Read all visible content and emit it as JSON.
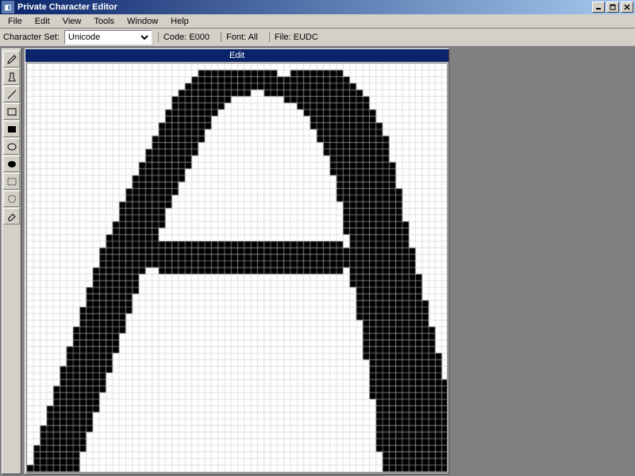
{
  "window": {
    "title": "Private Character Editor",
    "minimize": "_",
    "maximize": "□",
    "close": "×"
  },
  "menubar": [
    "File",
    "Edit",
    "View",
    "Tools",
    "Window",
    "Help"
  ],
  "toolbar": {
    "charset_label": "Character Set:",
    "charset_value": "Unicode",
    "code_label": "Code:",
    "code_value": "E000",
    "font_label": "Font:",
    "font_value": "All",
    "file_label": "File:",
    "file_value": "EUDC"
  },
  "tools": [
    {
      "name": "pencil-tool"
    },
    {
      "name": "brush-tool"
    },
    {
      "name": "line-tool"
    },
    {
      "name": "rect-tool"
    },
    {
      "name": "filled-rect-tool"
    },
    {
      "name": "ellipse-tool"
    },
    {
      "name": "filled-ellipse-tool"
    },
    {
      "name": "select-rect-tool"
    },
    {
      "name": "select-free-tool"
    },
    {
      "name": "eraser-tool"
    }
  ],
  "editor": {
    "title": "Edit",
    "grid_size": 64,
    "pixels": [
      "0000000000000000000000000000000000000000000000000000000000000000",
      "0000000000000000000000000011111111111100111111110000000000000000",
      "0000000000000000000000000111111111111111111111111000000000000000",
      "0000000000000000000000001111111111111111111111111100000000000000",
      "0000000000000000000000011111111111001111111111111110000000000000",
      "0000000000000000000000111111111000000001111111111111000000000000",
      "0000000000000000000000111111110000000000011111111111000000000000",
      "0000000000000000000001111111100000000000001111111111100000000000",
      "0000000000000000000001111111000000000000000111111111100000000000",
      "0000000000000000000011111111000000000000000111111111110000000000",
      "0000000000000000000011111110000000000000000011111111110000000000",
      "0000000000000000000111111110000000000000000011111111111000000000",
      "0000000000000000000111111100000000000000000001111111111000000000",
      "0000000000000000001111111100000000000000000001111111111000000000",
      "0000000000000000001111111000000000000000000000111111111000000000",
      "0000000000000000011111111000000000000000000000111111111100000000",
      "0000000000000000011111110000000000000000000000111111111100000000",
      "0000000000000000111111110000000000000000000000011111111100000000",
      "0000000000000000111111100000000000000000000000011111111100000000",
      "0000000000000001111111100000000000000000000000011111111110000000",
      "0000000000000001111111000000000000000000000000011111111110000000",
      "0000000000000011111111000000000000000000000000001111111110000000",
      "0000000000000011111110000000000000000000000000001111111110000000",
      "0000000000000011111110000000000000000000000000001111111110000000",
      "0000000000000111111110000000000000000000000000001111111111000000",
      "0000000000000111111100000000000000000000000000001111111111000000",
      "0000000000001111111100000000000000000000000000000111111111000000",
      "0000000000001111111111111111111111111111111111110111111111000000",
      "0000000000011111111111111111111111111111111111111111111111100000",
      "0000000000011111111111111111111111111111111111111111111111100000",
      "0000000000011111111111111111111111111111111111111111111111100000",
      "0000000000111111110011111111111111111111111111110111111111100000",
      "0000000000111111100000000000000000000000000000000111111111110000",
      "0000000000111111100000000000000000000000000000000111111111110000",
      "0000000001111111100000000000000000000000000000000011111111110000",
      "0000000001111111000000000000000000000000000000000011111111110000",
      "0000000001111111000000000000000000000000000000000011111111111000",
      "0000000011111111000000000000000000000000000000000011111111111000",
      "0000000011111110000000000000000000000000000000000011111111111000",
      "0000000011111110000000000000000000000000000000000001111111111000",
      "0000000111111110000000000000000000000000000000000001111111111100",
      "0000000111111100000000000000000000000000000000000001111111111100",
      "0000000111111100000000000000000000000000000000000001111111111100",
      "0000001111111100000000000000000000000000000000000001111111111100",
      "0000001111111000000000000000000000000000000000000001111111111110",
      "0000001111111000000000000000000000000000000000000000111111111110",
      "0000011111111000000000000000000000000000000000000000111111111110",
      "0000011111110000000000000000000000000000000000000000111111111110",
      "0000011111110000000000000000000000000000000000000000111111111111",
      "0000111111110000000000000000000000000000000000000000111111111111",
      "0000111111100000000000000000000000000000000000000000111111111111",
      "0000111111100000000000000000000000000000000000000000011111111111",
      "0001111111100000000000000000000000000000000000000000011111111111",
      "0001111111000000000000000000000000000000000000000000011111111111",
      "0001111111000000000000000000000000000000000000000000011111111111",
      "0011111111000000000000000000000000000000000000000000011111111111",
      "0011111110000000000000000000000000000000000000000000011111111111",
      "0011111110000000000000000000000000000000000000000000011111111111",
      "0111111110000000000000000000000000000000000000000000011111111111",
      "0111111100000000000000000000000000000000000000000000001111111111",
      "0111111100000000000000000000000000000000000000000000001111111111",
      "1111111100000000000000000000000000000000000000000000001111111111",
      "1111111100000000000000000000000000000000000000000000001111111111",
      "1111111000000000000000000000000000000000000000000000001111111111"
    ]
  }
}
